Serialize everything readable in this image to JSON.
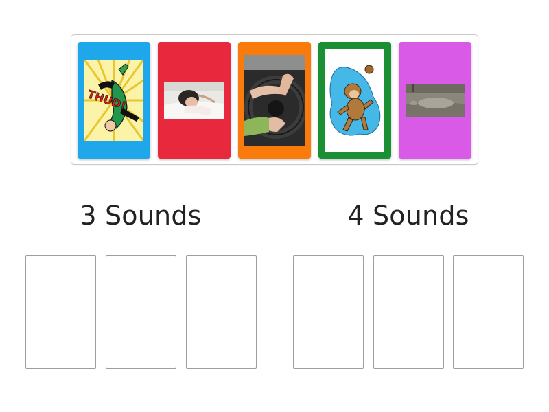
{
  "cards": [
    {
      "name": "thud-card",
      "color": "#1ea7ea",
      "picture": "comic-fall-thud",
      "caption": "THUD!"
    },
    {
      "name": "sleeping-girl-card",
      "color": "#e8283d",
      "picture": "girl-sleeping-on-bed"
    },
    {
      "name": "steering-wheel-card",
      "color": "#f97b0b",
      "picture": "hands-on-steering-wheel"
    },
    {
      "name": "monkey-card",
      "color": "#1b8f34",
      "picture": "cartoon-monkey-with-coconut"
    },
    {
      "name": "animal-mud-card",
      "color": "#d85ae6",
      "picture": "animal-lying-in-mud"
    }
  ],
  "groups": [
    {
      "title": "3 Sounds",
      "slots": 3
    },
    {
      "title": "4 Sounds",
      "slots": 3
    }
  ]
}
